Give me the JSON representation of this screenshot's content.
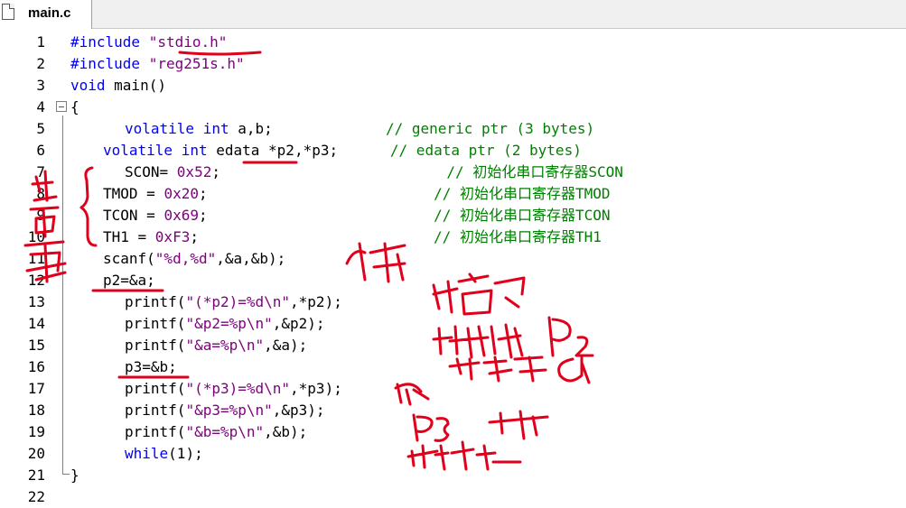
{
  "tab": {
    "filename": "main.c",
    "icon": "file-icon"
  },
  "lines": [
    {
      "n": "1",
      "indent": 78,
      "parts": [
        {
          "c": "kw",
          "t": "#include"
        },
        {
          "c": "",
          "t": " "
        },
        {
          "c": "str",
          "t": "\"stdio.h\""
        }
      ]
    },
    {
      "n": "2",
      "indent": 78,
      "parts": [
        {
          "c": "kw",
          "t": "#include"
        },
        {
          "c": "",
          "t": " "
        },
        {
          "c": "str",
          "t": "\"reg251s.h\""
        }
      ]
    },
    {
      "n": "3",
      "indent": 78,
      "parts": [
        {
          "c": "kw",
          "t": "void"
        },
        {
          "c": "",
          "t": " main()"
        }
      ]
    },
    {
      "n": "4",
      "indent": 78,
      "parts": [
        {
          "c": "",
          "t": "{"
        }
      ]
    },
    {
      "n": "5",
      "indent": 138,
      "parts": [
        {
          "c": "kw",
          "t": "volatile"
        },
        {
          "c": "",
          "t": " "
        },
        {
          "c": "kw",
          "t": "int"
        },
        {
          "c": "",
          "t": " a,b;             "
        },
        {
          "c": "cm",
          "t": "// generic ptr (3 bytes)"
        }
      ]
    },
    {
      "n": "6",
      "indent": 114,
      "parts": [
        {
          "c": "kw",
          "t": "volatile"
        },
        {
          "c": "",
          "t": " "
        },
        {
          "c": "kw",
          "t": "int"
        },
        {
          "c": "",
          "t": " edata *p2,*p3;      "
        },
        {
          "c": "cm",
          "t": "// edata ptr (2 bytes)"
        }
      ]
    },
    {
      "n": "7",
      "indent": 138,
      "parts": [
        {
          "c": "",
          "t": "SCON= "
        },
        {
          "c": "num",
          "t": "0x52"
        },
        {
          "c": "",
          "t": ";                          "
        },
        {
          "c": "cm",
          "t": "// 初始化串口寄存器SCON"
        }
      ]
    },
    {
      "n": "8",
      "indent": 114,
      "parts": [
        {
          "c": "",
          "t": "TMOD = "
        },
        {
          "c": "num",
          "t": "0x20"
        },
        {
          "c": "",
          "t": ";                          "
        },
        {
          "c": "cm",
          "t": "// 初始化串口寄存器TMOD"
        }
      ]
    },
    {
      "n": "9",
      "indent": 114,
      "parts": [
        {
          "c": "",
          "t": "TCON = "
        },
        {
          "c": "num",
          "t": "0x69"
        },
        {
          "c": "",
          "t": ";                          "
        },
        {
          "c": "cm",
          "t": "// 初始化串口寄存器TCON"
        }
      ]
    },
    {
      "n": "10",
      "indent": 114,
      "parts": [
        {
          "c": "",
          "t": "TH1 = "
        },
        {
          "c": "num",
          "t": "0xF3"
        },
        {
          "c": "",
          "t": ";                           "
        },
        {
          "c": "cm",
          "t": "// 初始化串口寄存器TH1"
        }
      ]
    },
    {
      "n": "11",
      "indent": 114,
      "parts": [
        {
          "c": "",
          "t": "scanf("
        },
        {
          "c": "str",
          "t": "\"%d,%d\""
        },
        {
          "c": "",
          "t": ",&a,&b);"
        }
      ]
    },
    {
      "n": "12",
      "indent": 114,
      "parts": [
        {
          "c": "",
          "t": "p2=&a;"
        }
      ]
    },
    {
      "n": "13",
      "indent": 138,
      "parts": [
        {
          "c": "",
          "t": "printf("
        },
        {
          "c": "str",
          "t": "\"(*p2)=%d\\n\""
        },
        {
          "c": "",
          "t": ",*p2);"
        }
      ]
    },
    {
      "n": "14",
      "indent": 138,
      "parts": [
        {
          "c": "",
          "t": "printf("
        },
        {
          "c": "str",
          "t": "\"&p2=%p\\n\""
        },
        {
          "c": "",
          "t": ",&p2);"
        }
      ]
    },
    {
      "n": "15",
      "indent": 138,
      "parts": [
        {
          "c": "",
          "t": "printf("
        },
        {
          "c": "str",
          "t": "\"&a=%p\\n\""
        },
        {
          "c": "",
          "t": ",&a);"
        }
      ]
    },
    {
      "n": "16",
      "indent": 138,
      "parts": [
        {
          "c": "",
          "t": "p3=&b;"
        }
      ]
    },
    {
      "n": "17",
      "indent": 138,
      "parts": [
        {
          "c": "",
          "t": "printf("
        },
        {
          "c": "str",
          "t": "\"(*p3)=%d\\n\""
        },
        {
          "c": "",
          "t": ",*p3);"
        }
      ]
    },
    {
      "n": "18",
      "indent": 138,
      "parts": [
        {
          "c": "",
          "t": "printf("
        },
        {
          "c": "str",
          "t": "\"&p3=%p\\n\""
        },
        {
          "c": "",
          "t": ",&p3);"
        }
      ]
    },
    {
      "n": "19",
      "indent": 138,
      "parts": [
        {
          "c": "",
          "t": "printf("
        },
        {
          "c": "str",
          "t": "\"&b=%p\\n\""
        },
        {
          "c": "",
          "t": ",&b);"
        }
      ]
    },
    {
      "n": "20",
      "indent": 138,
      "parts": [
        {
          "c": "kw",
          "t": "while"
        },
        {
          "c": "",
          "t": "(1);"
        }
      ]
    },
    {
      "n": "21",
      "indent": 78,
      "parts": [
        {
          "c": "",
          "t": "}"
        }
      ]
    },
    {
      "n": "22",
      "indent": 78,
      "parts": []
    }
  ],
  "colors": {
    "keyword": "#0000ff",
    "string": "#800080",
    "comment": "#008000",
    "annotation_ink": "#e0001b"
  }
}
